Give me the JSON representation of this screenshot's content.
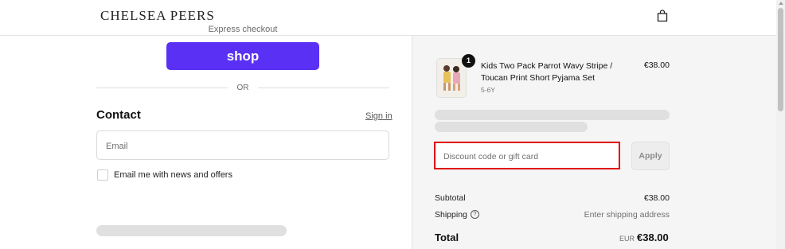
{
  "header": {
    "brand": "CHELSEA PEERS",
    "cart_icon": "shopping-bag-icon"
  },
  "checkout": {
    "express_label": "Express checkout",
    "shop_button_label": "shop",
    "divider_text": "OR",
    "contact_title": "Contact",
    "sign_in_label": "Sign in",
    "email_placeholder": "Email",
    "email_value": "",
    "newsletter_label": "Email me with news and offers",
    "newsletter_checked": false
  },
  "summary": {
    "product": {
      "name": "Kids Two Pack Parrot Wavy Stripe / Toucan Print Short Pyjama Set",
      "variant": "5-6Y",
      "price": "€38.00",
      "quantity": "1"
    },
    "discount_placeholder": "Discount code or gift card",
    "apply_label": "Apply",
    "subtotal_label": "Subtotal",
    "subtotal_value": "€38.00",
    "shipping_label": "Shipping",
    "shipping_value": "Enter shipping address",
    "total_label": "Total",
    "currency_code": "EUR",
    "total_value": "€38.00"
  },
  "colors": {
    "shop_button": "#5a31f4",
    "highlight_border": "#e00000",
    "summary_background": "#f5f5f5"
  }
}
